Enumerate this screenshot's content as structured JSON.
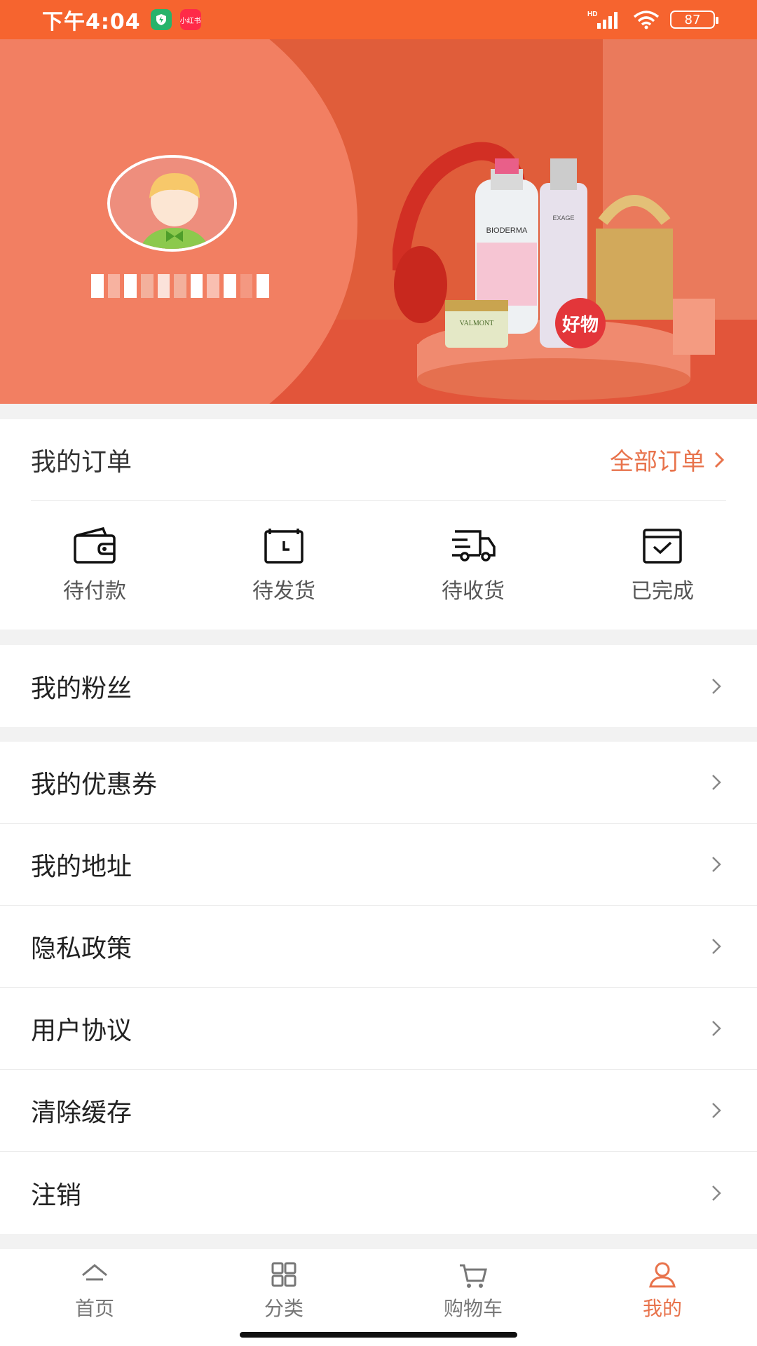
{
  "status_bar": {
    "time": "下午4:04",
    "app_badge": "小红书",
    "network": "HD",
    "battery": "87"
  },
  "profile": {
    "username": ""
  },
  "banner": {
    "brand_1": "BIODERMA",
    "brand_2": "EXAGE",
    "brand_3": "VALMONT",
    "badge": "好物"
  },
  "orders": {
    "title": "我的订单",
    "all_label": "全部订单",
    "items": [
      {
        "label": "待付款",
        "icon": "wallet-icon"
      },
      {
        "label": "待发货",
        "icon": "clock-icon"
      },
      {
        "label": "待收货",
        "icon": "truck-icon"
      },
      {
        "label": "已完成",
        "icon": "check-box-icon"
      }
    ]
  },
  "menu": {
    "fans": "我的粉丝",
    "coupons": "我的优惠券",
    "address": "我的地址",
    "privacy": "隐私政策",
    "agreement": "用户协议",
    "clear_cache": "清除缓存",
    "logout": "注销"
  },
  "bottom_nav": {
    "items": [
      {
        "label": "首页",
        "icon": "home-icon",
        "active": false
      },
      {
        "label": "分类",
        "icon": "grid-icon",
        "active": false
      },
      {
        "label": "购物车",
        "icon": "cart-icon",
        "active": false
      },
      {
        "label": "我的",
        "icon": "user-icon",
        "active": true
      }
    ]
  },
  "colors": {
    "accent": "#f6642f",
    "banner": "#e05d3a",
    "link": "#e8734c"
  }
}
